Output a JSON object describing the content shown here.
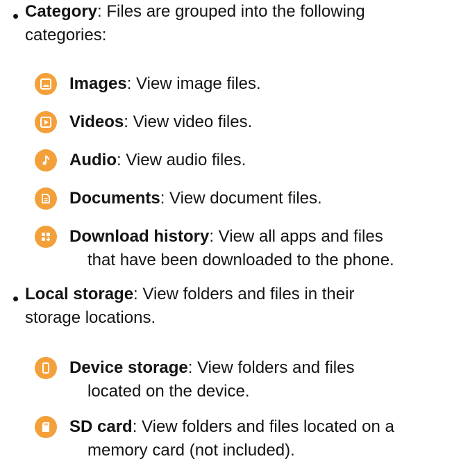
{
  "sections": [
    {
      "term": "Category",
      "description": ": Files are grouped into the following",
      "continuation": "categories:",
      "items": [
        {
          "icon": "images-icon",
          "term": "Images",
          "description": ": View image files."
        },
        {
          "icon": "videos-icon",
          "term": "Videos",
          "description": ": View video files."
        },
        {
          "icon": "audio-icon",
          "term": "Audio",
          "description": ": View audio files."
        },
        {
          "icon": "documents-icon",
          "term": "Documents",
          "description": ": View document files."
        },
        {
          "icon": "download-history-icon",
          "term": "Download history",
          "description": ": View all apps and files",
          "continuation": "that have been downloaded to the phone."
        }
      ]
    },
    {
      "term": "Local storage",
      "description": ": View folders and files in their",
      "continuation": "storage locations.",
      "items": [
        {
          "icon": "device-storage-icon",
          "term": "Device storage",
          "description": ": View folders and files",
          "continuation": "located on the device."
        },
        {
          "icon": "sd-card-icon",
          "term": "SD card",
          "description": ": View folders and files located on a",
          "continuation": "memory card (not included)."
        }
      ]
    }
  ],
  "colors": {
    "icon_background": "#f4a03a",
    "text": "#141414"
  }
}
